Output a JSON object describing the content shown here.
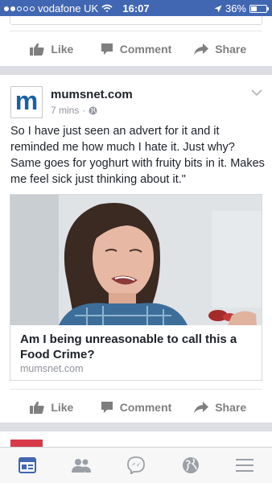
{
  "status_bar": {
    "carrier": "vodafone UK",
    "time": "16:07",
    "battery": "36%"
  },
  "top_post": {
    "actions": {
      "like": "Like",
      "comment": "Comment",
      "share": "Share"
    }
  },
  "post": {
    "page_name": "mumsnet.com",
    "logo_letter": "m",
    "time": "7 mins",
    "separator": "·",
    "privacy_icon": "globe-icon",
    "text": "So I have just seen an advert for it and it reminded me how much I hate it.  Just why? Same goes for yoghurt with fruity bits in it. Makes me feel sick just thinking about it.\"",
    "link": {
      "title": "Am I being unreasonable to call this a Food Crime?",
      "domain": "mumsnet.com"
    },
    "actions": {
      "like": "Like",
      "comment": "Comment",
      "share": "Share"
    }
  },
  "tab_bar": {
    "tabs": [
      "news-feed-icon",
      "friends-icon",
      "messenger-icon",
      "notifications-globe-icon",
      "menu-icon"
    ],
    "active_tab": "news-feed-icon"
  },
  "colors": {
    "brand_blue": "#4267b2",
    "mumsnet_blue": "#1a60a8",
    "action_gray": "#7f7f7f",
    "meta_gray": "#90949c"
  }
}
